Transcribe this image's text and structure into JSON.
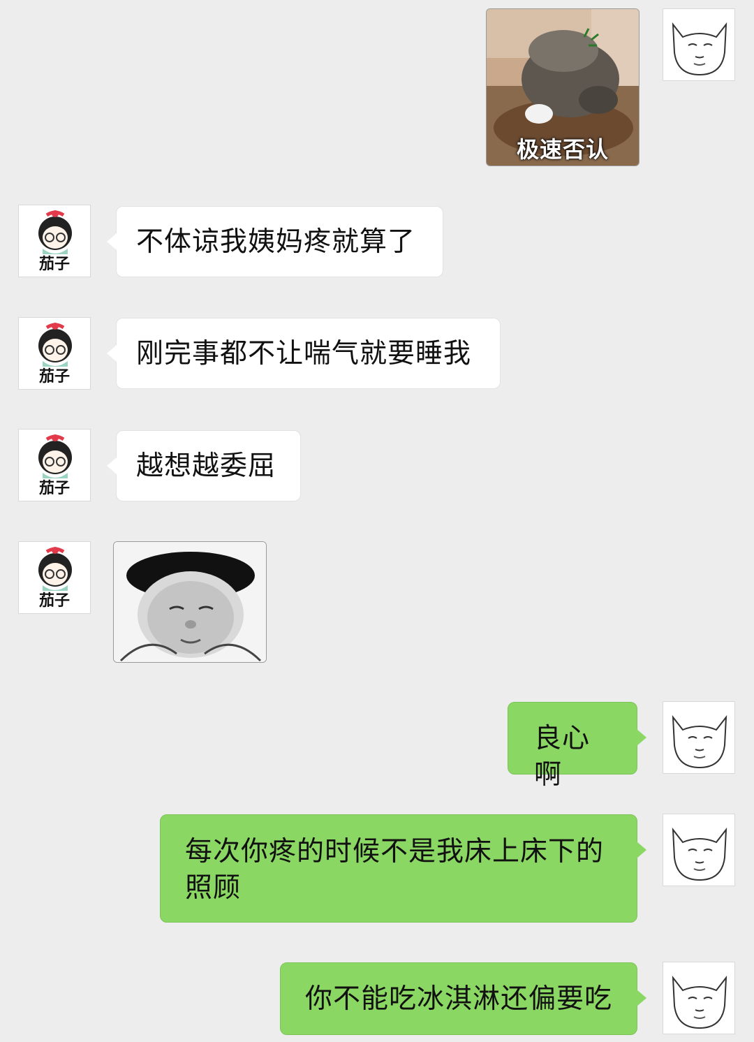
{
  "contacts": {
    "other": {
      "avatar_name": "茄子"
    }
  },
  "messages": {
    "m1_sticker_caption": "极速否认",
    "m2_text": "不体谅我姨妈疼就算了",
    "m3_text": "刚完事都不让喘气就要睡我",
    "m4_text": "越想越委屈",
    "m6_text": "良心啊",
    "m7_text": "每次你疼的时候不是我床上床下的照顾",
    "m8_text": "你不能吃冰淇淋还偏要吃"
  },
  "colors": {
    "background": "#ededed",
    "incoming_bubble": "#ffffff",
    "outgoing_bubble": "#8bd764"
  }
}
